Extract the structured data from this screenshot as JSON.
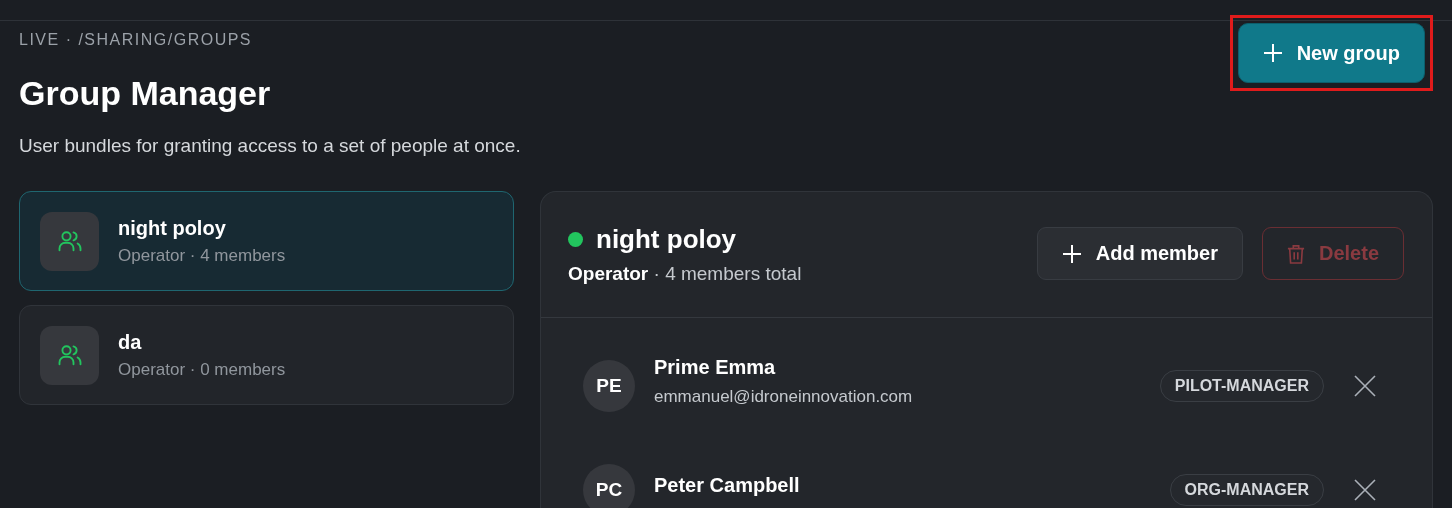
{
  "breadcrumb": "LIVE · /SHARING/GROUPS",
  "title": "Group Manager",
  "subtitle": "User bundles for granting access to a set of people at once.",
  "new_group_button": {
    "label": "New group",
    "highlighted": true
  },
  "groups": [
    {
      "name": "night poloy",
      "meta": "Operator · 4 members",
      "selected": true
    },
    {
      "name": "da",
      "meta": "Operator · 0 members",
      "selected": false
    }
  ],
  "detail": {
    "name": "night poloy",
    "active": true,
    "role": "Operator",
    "summary": " · 4 members total",
    "add_button": "Add member",
    "delete_button": {
      "label": "Delete",
      "disabled": true
    },
    "members": [
      {
        "initials": "PE",
        "name": "Prime Emma",
        "email": "emmanuel@idroneinnovation.com",
        "role": "PILOT-MANAGER"
      },
      {
        "initials": "PC",
        "name": "Peter Campbell",
        "role": "ORG-MANAGER"
      }
    ]
  }
}
